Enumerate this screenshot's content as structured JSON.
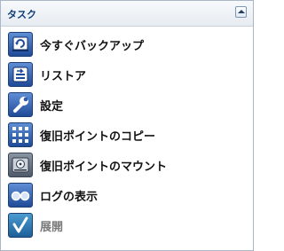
{
  "panel": {
    "title": "タスク",
    "collapse_icon": "chevron-up-icon"
  },
  "tasks": [
    {
      "label": "今すぐバックアップ",
      "icon": "backup-now-icon",
      "enabled": true
    },
    {
      "label": "リストア",
      "icon": "restore-icon",
      "enabled": true
    },
    {
      "label": "設定",
      "icon": "settings-wrench-icon",
      "enabled": true
    },
    {
      "label": "復旧ポイントのコピー",
      "icon": "copy-recovery-point-icon",
      "enabled": true
    },
    {
      "label": "復旧ポイントのマウント",
      "icon": "mount-recovery-point-icon",
      "enabled": true
    },
    {
      "label": "ログの表示",
      "icon": "view-logs-icon",
      "enabled": true
    },
    {
      "label": "展開",
      "icon": "deploy-icon",
      "enabled": false
    }
  ],
  "colors": {
    "header_text": "#0d3d7a",
    "icon_blue": "#1f4a98",
    "disabled_text": "#7b7b7b"
  }
}
